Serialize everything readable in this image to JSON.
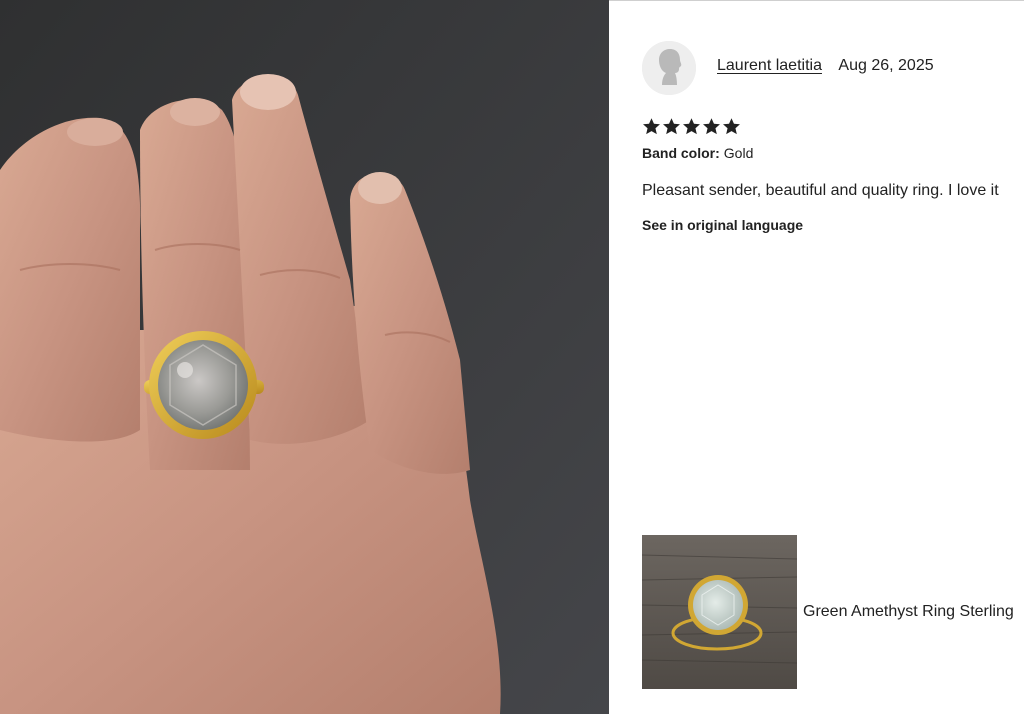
{
  "review": {
    "reviewer_name": "Laurent laetitia",
    "date": "Aug 26, 2025",
    "rating": 5,
    "band_color_label": "Band color:",
    "band_color_value": "Gold",
    "text": "Pleasant sender, beautiful and quality ring. I love it",
    "translate_link": "See in original language"
  },
  "product": {
    "title": "Green Amethyst Ring Sterling"
  },
  "icons": {
    "avatar": "default-avatar-silhouette",
    "star": "filled-star-icon"
  },
  "colors": {
    "star": "#222222",
    "gold": "#c9a227",
    "background_photo": "#3d3e3f"
  }
}
